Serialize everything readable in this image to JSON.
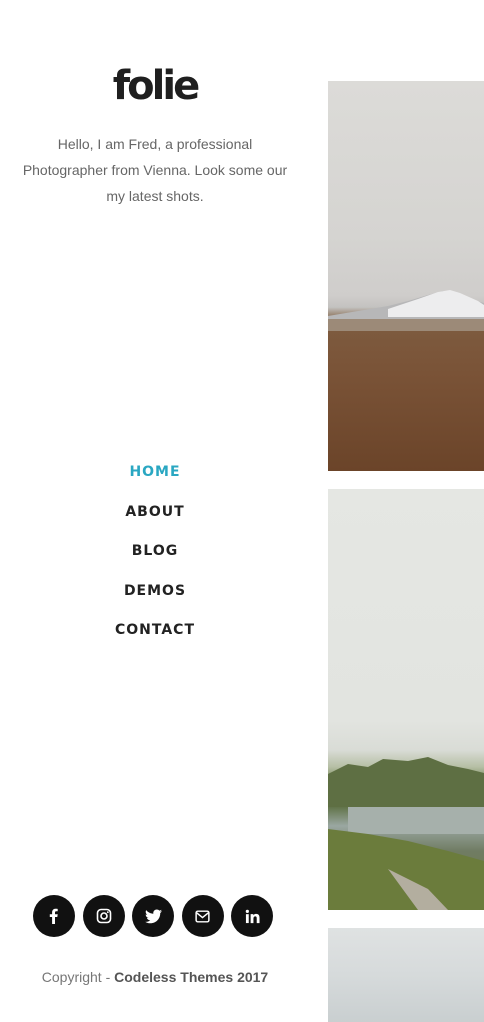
{
  "logo": "folie",
  "intro": "Hello, I am Fred, a professional Photographer from Vienna. Look some our my latest shots.",
  "nav": [
    {
      "label": "HOME",
      "active": true
    },
    {
      "label": "ABOUT",
      "active": false
    },
    {
      "label": "BLOG",
      "active": false
    },
    {
      "label": "DEMOS",
      "active": false
    },
    {
      "label": "CONTACT",
      "active": false
    }
  ],
  "social": [
    "facebook-icon",
    "instagram-icon",
    "twitter-icon",
    "email-icon",
    "linkedin-icon"
  ],
  "footer": {
    "prefix": "Copyright - ",
    "strong": "Codeless Themes 2017"
  },
  "colors": {
    "accent": "#2aa7c2",
    "text": "#222222",
    "icon_bg": "#111111"
  }
}
